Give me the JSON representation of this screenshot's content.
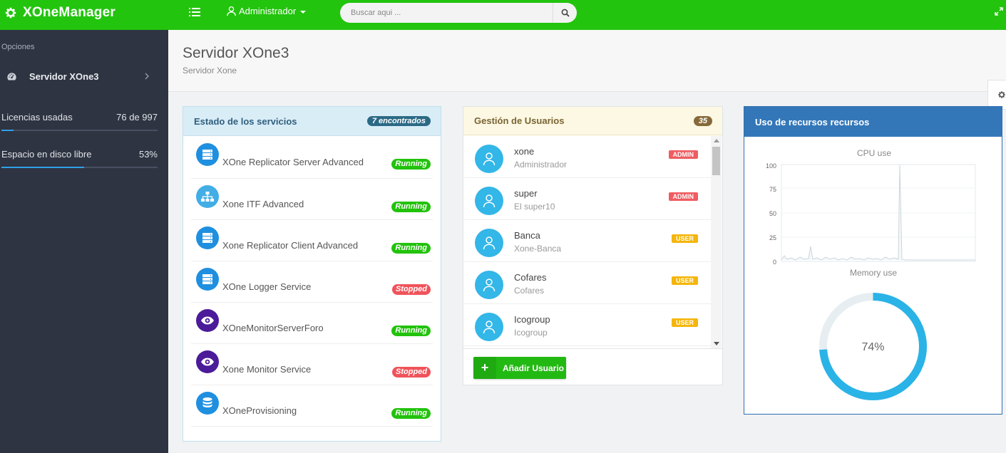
{
  "topbar": {
    "brand": "XOneManager",
    "user": "Administrador",
    "search_placeholder": "Buscar aqui ..."
  },
  "sidebar": {
    "heading": "Opciones",
    "server_item": "Servidor XOne3",
    "stats": [
      {
        "label": "Licencias usadas",
        "value": "76 de 997",
        "fraction": 0.076
      },
      {
        "label": "Espacio en disco libre",
        "value": "53%",
        "fraction": 0.53
      }
    ]
  },
  "page": {
    "title": "Servidor XOne3",
    "subtitle": "Servidor Xone"
  },
  "services": {
    "title": "Estado de los servicios",
    "badge": "7 encontrados",
    "items": [
      {
        "name": "XOne Replicator Server Advanced",
        "status": "Running",
        "icon": "server-icon"
      },
      {
        "name": "Xone ITF Advanced",
        "status": "Running",
        "icon": "sitemap-icon"
      },
      {
        "name": "Xone Replicator Client Advanced",
        "status": "Running",
        "icon": "server-icon"
      },
      {
        "name": "XOne Logger Service",
        "status": "Stopped",
        "icon": "server-icon"
      },
      {
        "name": "XOneMonitorServerForo",
        "status": "Running",
        "icon": "eye-icon"
      },
      {
        "name": "Xone Monitor Service",
        "status": "Stopped",
        "icon": "eye-icon"
      },
      {
        "name": "XOneProvisioning",
        "status": "Running",
        "icon": "database-icon"
      }
    ]
  },
  "users": {
    "title": "Gestión de Usuarios",
    "count": "35",
    "items": [
      {
        "name": "xone",
        "desc": "Administrador",
        "role": "ADMIN"
      },
      {
        "name": "super",
        "desc": "El super10",
        "role": "ADMIN"
      },
      {
        "name": "Banca",
        "desc": "Xone-Banca",
        "role": "USER"
      },
      {
        "name": "Cofares",
        "desc": "Cofares",
        "role": "USER"
      },
      {
        "name": "Icogroup",
        "desc": "Icogroup",
        "role": "USER"
      }
    ],
    "add_button": "Añadir Usuario"
  },
  "resources": {
    "title": "Uso de recursos recursos",
    "cpu_title": "CPU use",
    "memory_title": "Memory use",
    "memory_value": "74%",
    "memory_fraction": 0.74,
    "cpu_ticks": [
      "100",
      "75",
      "50",
      "25",
      "0"
    ]
  },
  "colors": {
    "topbar": "#23c40e",
    "sidebar": "#2f3442",
    "running": "#22c20c",
    "stopped": "#f0535a",
    "admin": "#ef5c61",
    "user": "#f5b50a",
    "avatar": "#33b6e8",
    "ring": "#2ab3e6"
  }
}
